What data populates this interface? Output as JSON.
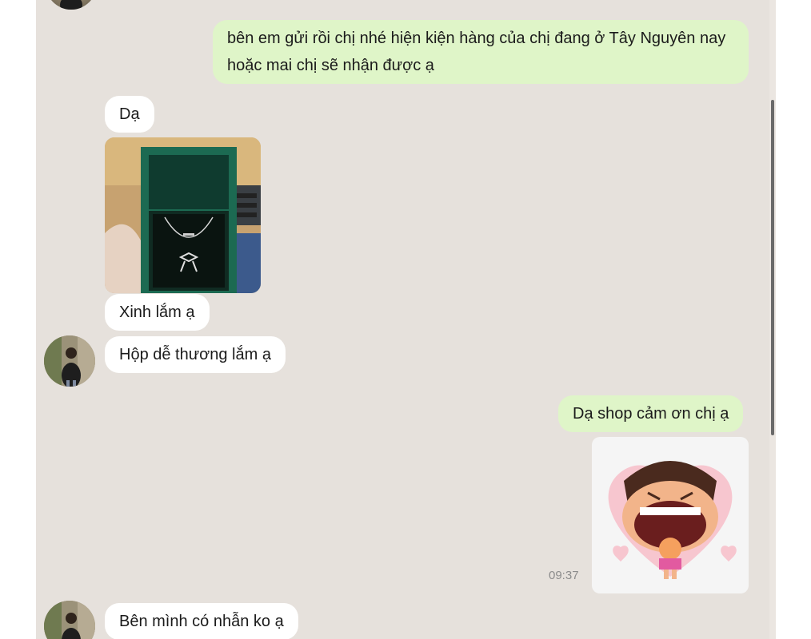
{
  "conversation": {
    "messages": [
      {
        "direction": "out",
        "text": "bên em gửi rồi chị nhé hiện kiện hàng của chị đang ở Tây Nguyên nay hoặc mai chị sẽ nhận được ạ"
      },
      {
        "direction": "in",
        "text": "Dạ"
      },
      {
        "direction": "in",
        "image": "necklace-box-photo"
      },
      {
        "direction": "in",
        "text": "Xinh lắm ạ"
      },
      {
        "direction": "in",
        "text": "Hộp dễ thương lắm ạ"
      },
      {
        "direction": "out",
        "text": "Dạ shop cảm ơn chị ạ"
      },
      {
        "direction": "out",
        "sticker": "laughing-character-heart-sticker",
        "time": "09:37"
      },
      {
        "direction": "in",
        "text": "Bên mình có nhẫn ko ạ"
      }
    ]
  },
  "colors": {
    "chat_background": "#e6e1dc",
    "incoming_bubble": "#ffffff",
    "outgoing_bubble": "#dff5c8",
    "timestamp": "#8c8c8c"
  },
  "icons": {
    "avatar": "user-avatar-photo",
    "scrollbar": "vertical-scrollbar"
  }
}
